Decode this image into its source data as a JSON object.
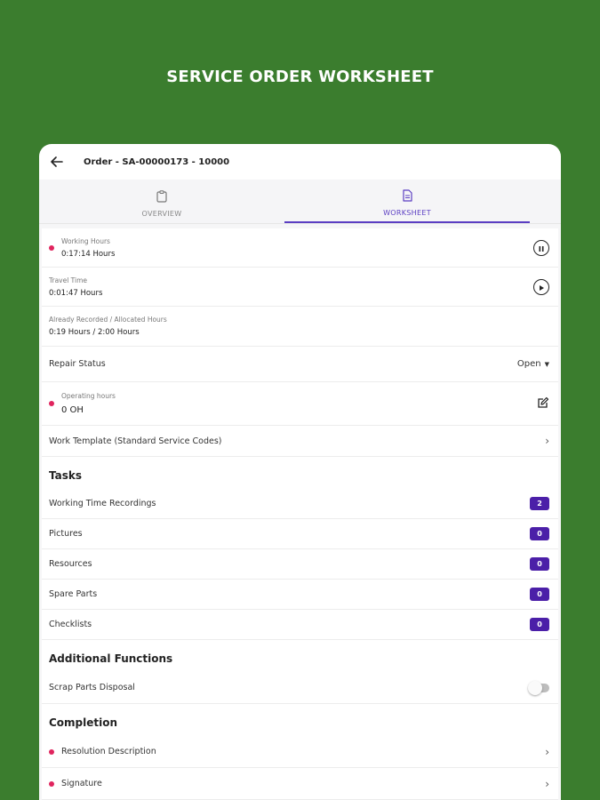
{
  "banner": {
    "title": "SERVICE ORDER WORKSHEET"
  },
  "header": {
    "order_title": "Order - SA-00000173 - 10000"
  },
  "tabs": [
    {
      "label": "OVERVIEW",
      "icon": "clipboard-icon",
      "active": false
    },
    {
      "label": "WORKSHEET",
      "icon": "document-icon",
      "active": true
    }
  ],
  "time": {
    "working_label": "Working Hours",
    "working_value": "0:17:14 Hours",
    "travel_label": "Travel Time",
    "travel_value": "0:01:47 Hours",
    "recorded_label": "Already Recorded / Allocated Hours",
    "recorded_value": "0:19 Hours / 2:00 Hours"
  },
  "repair": {
    "label": "Repair Status",
    "value": "Open"
  },
  "operating": {
    "label": "Operating hours",
    "value": "0 OH"
  },
  "work_template": {
    "label": "Work Template (Standard Service Codes)"
  },
  "tasks": {
    "title": "Tasks",
    "items": [
      {
        "label": "Working Time Recordings",
        "count": "2"
      },
      {
        "label": "Pictures",
        "count": "0"
      },
      {
        "label": "Resources",
        "count": "0"
      },
      {
        "label": "Spare Parts",
        "count": "0"
      },
      {
        "label": "Checklists",
        "count": "0"
      }
    ]
  },
  "additional": {
    "title": "Additional Functions",
    "scrap_label": "Scrap Parts Disposal"
  },
  "completion": {
    "title": "Completion",
    "items": [
      {
        "label": "Resolution Description"
      },
      {
        "label": "Signature"
      }
    ]
  },
  "colors": {
    "background": "#3b7d2e",
    "accent": "#5b3ec2",
    "badge": "#4b1fa8",
    "required_dot": "#e0245e"
  }
}
